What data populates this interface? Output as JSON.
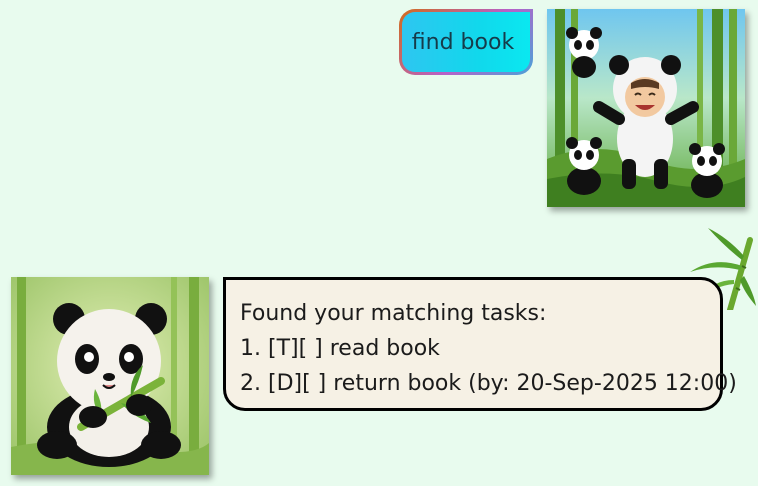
{
  "user_message": {
    "text": "find book"
  },
  "bot_message": {
    "lines": [
      "Found your matching tasks:",
      "1. [T][ ] read book",
      "2. [D][ ] return book (by: 20-Sep-2025 12:00)"
    ]
  },
  "avatars": {
    "user": "child-in-panda-costume-avatar",
    "bot": "panda-eating-bamboo-avatar"
  },
  "decoration": "bamboo-sprig-icon",
  "colors": {
    "background": "#e8fbee",
    "user_bubble": "#11d8ec",
    "bot_bubble": "#f6f1e5",
    "bot_border": "#000000"
  }
}
